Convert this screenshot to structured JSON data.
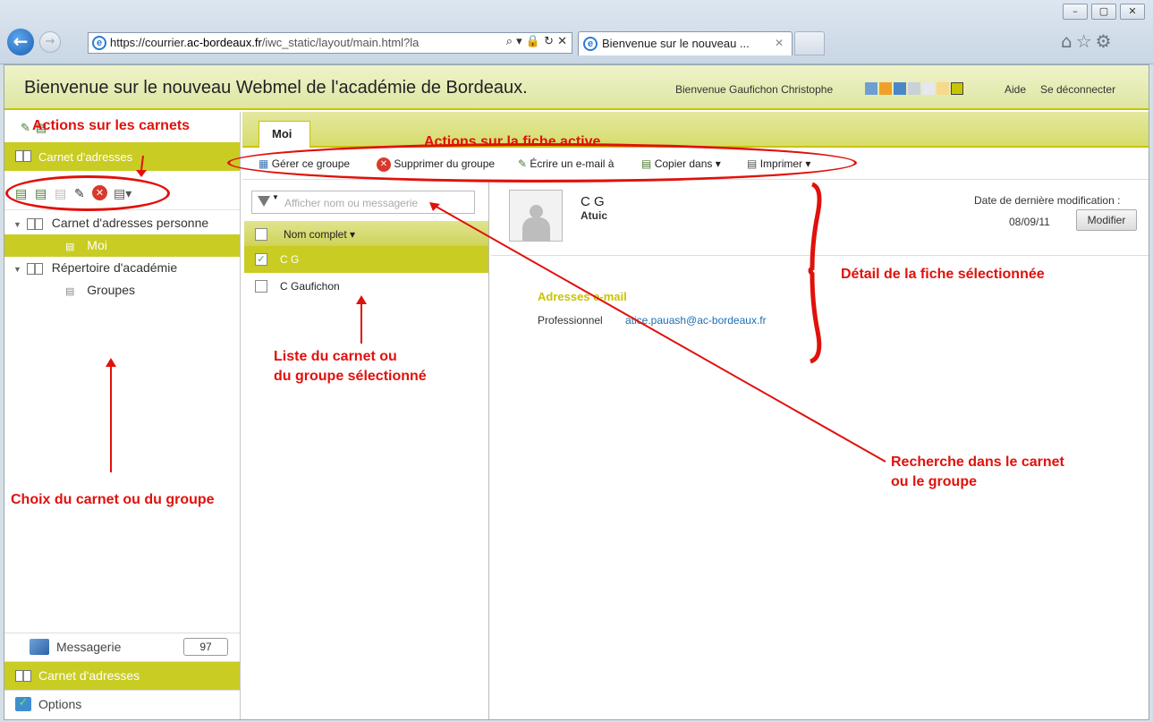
{
  "browser": {
    "window_controls": [
      "–",
      "▢",
      "✕"
    ],
    "url_prefix": "https://courrier.",
    "url_domain": "ac-bordeaux.fr",
    "url_path": "/iwc_static/layout/main.html?la",
    "address_controls": "⌕ ▾ 🔒 ↻ ✕",
    "tab_title": "Bienvenue sur le nouveau ...",
    "tab_close": "✕",
    "tools": "⌂☆⚙"
  },
  "header": {
    "title": "Bienvenue sur le nouveau Webmel de l'académie de Bordeaux.",
    "welcome": "Bienvenue Gaufichon Christophe",
    "theme_colors": [
      "#6f9fd2",
      "#f0a02a",
      "#4a86c8",
      "#c9d0d8",
      "#e6e8ee",
      "#f6d98a",
      "#c8c400"
    ],
    "help": "Aide",
    "logout": "Se déconnecter"
  },
  "left": {
    "section_title": "Carnet d'adresses",
    "tree": [
      {
        "label": "Carnet d'adresses personne"
      },
      {
        "label": "Moi"
      },
      {
        "label": "Répertoire d'académie"
      },
      {
        "label": "Groupes"
      }
    ],
    "nav": [
      {
        "label": "Messagerie",
        "count": "97"
      },
      {
        "label": "Carnet d'adresses"
      },
      {
        "label": "Options"
      }
    ]
  },
  "main": {
    "tab": "Moi",
    "actions": {
      "manage_group": "Gérer ce groupe",
      "remove_from_group": "Supprimer du groupe",
      "write_email": "Écrire un e-mail à",
      "copy_to": "Copier dans",
      "print": "Imprimer"
    },
    "search_placeholder": "Afficher nom ou messagerie",
    "list_header": "Nom complet",
    "list_rows": [
      {
        "name": "C G",
        "checked": true
      },
      {
        "name": "C Gaufichon",
        "checked": false
      }
    ]
  },
  "detail": {
    "name": "C G",
    "organization": "Atuic",
    "modified_label": "Date de dernière modification :",
    "modified_date": "08/09/11",
    "modify_button": "Modifier",
    "email_heading": "Adresses e-mail",
    "email_type": "Professionnel",
    "email_value": "atice.pauash@ac-bordeaux.fr"
  },
  "annotations": {
    "notebook_actions": "Actions sur les carnets",
    "active_card_actions": "Actions sur la fiche active",
    "selected_card_detail": "Détail de la fiche sélectionnée",
    "list_label_line1": "Liste du carnet ou",
    "list_label_line2": "du groupe sélectionné",
    "search_label_line1": "Recherche dans le carnet",
    "search_label_line2": "ou le groupe",
    "choice_label": "Choix du carnet ou du groupe"
  }
}
